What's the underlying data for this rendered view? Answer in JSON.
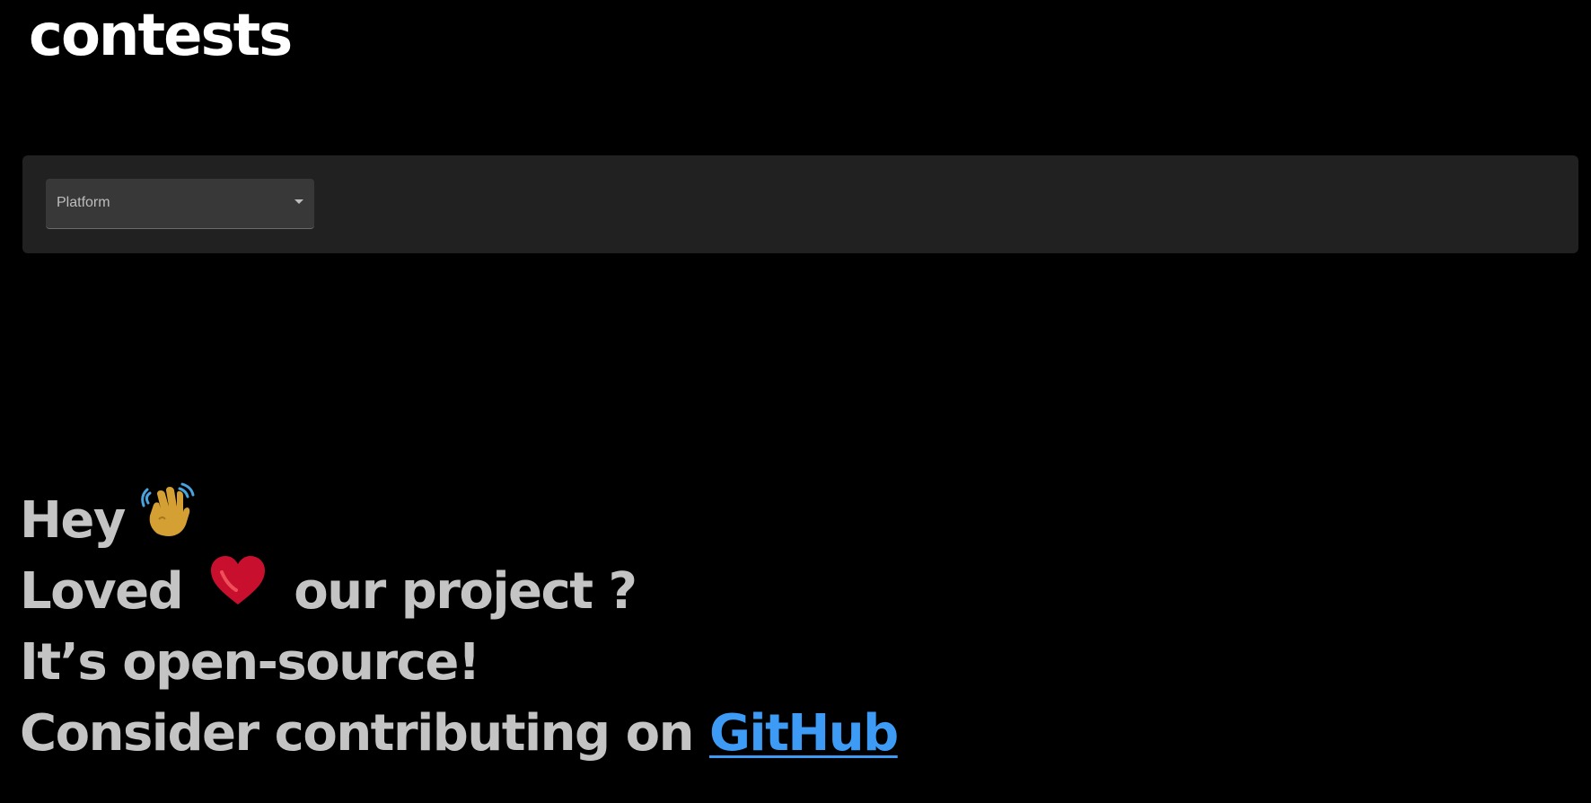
{
  "header": {
    "title": "contests"
  },
  "filters": {
    "platform_label": "Platform",
    "platform_icon": "chevron-down-icon"
  },
  "footer_message": {
    "line1_text": "Hey",
    "line1_icon": "waving-hand-icon",
    "line2_before": "Loved",
    "line2_icon": "heart-icon",
    "line2_after": "our project ?",
    "line3_text": "It’s open-source!",
    "line4_text": "Consider contributing on",
    "github_link": "GitHub"
  },
  "colors": {
    "background": "#000000",
    "panel": "#212121",
    "select": "#383838",
    "title": "#ffffff",
    "message_text": "#c4c4c4",
    "link": "#3d9bf5",
    "heart": "#c8102e",
    "hand": "#d4a033"
  }
}
